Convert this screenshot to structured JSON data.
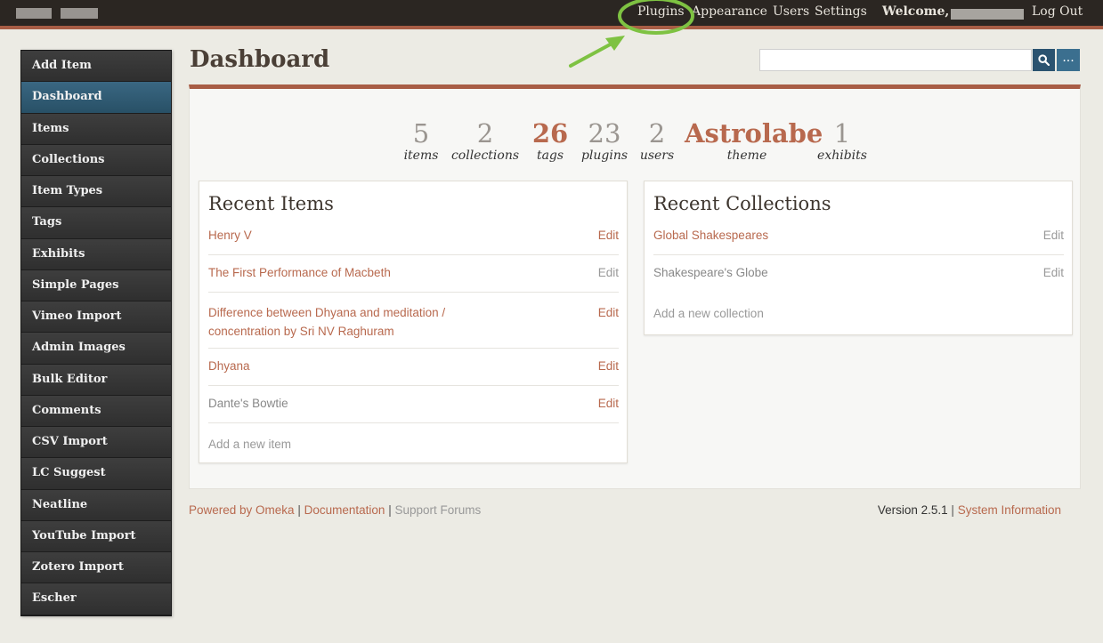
{
  "topbar": {
    "nav": [
      "Plugins",
      "Appearance",
      "Users",
      "Settings"
    ],
    "welcome": "Welcome,",
    "logout": "Log Out"
  },
  "sidebar": {
    "items": [
      {
        "label": "Add Item"
      },
      {
        "label": "Dashboard",
        "active": true
      },
      {
        "label": "Items"
      },
      {
        "label": "Collections"
      },
      {
        "label": "Item Types"
      },
      {
        "label": "Tags"
      },
      {
        "label": "Exhibits"
      },
      {
        "label": "Simple Pages"
      },
      {
        "label": "Vimeo Import"
      },
      {
        "label": "Admin Images"
      },
      {
        "label": "Bulk Editor"
      },
      {
        "label": "Comments"
      },
      {
        "label": "CSV Import"
      },
      {
        "label": "LC Suggest"
      },
      {
        "label": "Neatline"
      },
      {
        "label": "YouTube Import"
      },
      {
        "label": "Zotero Import"
      },
      {
        "label": "Escher"
      }
    ]
  },
  "header": {
    "title": "Dashboard",
    "search_value": "",
    "more_label": "..."
  },
  "stats": [
    {
      "value": "5",
      "label": "items"
    },
    {
      "value": "2",
      "label": "collections"
    },
    {
      "value": "26",
      "label": "tags"
    },
    {
      "value": "23",
      "label": "plugins"
    },
    {
      "value": "2",
      "label": "users"
    },
    {
      "value": "Astrolabe",
      "label": "theme"
    },
    {
      "value": "1",
      "label": "exhibits"
    }
  ],
  "recent_items": {
    "title": "Recent Items",
    "rows": [
      {
        "title": "Henry V",
        "edit": "Edit"
      },
      {
        "title": "The First Performance of Macbeth",
        "edit": "Edit"
      },
      {
        "title_line1": "Difference between Dhyana and meditation /",
        "title_line2": "concentration by Sri NV Raghuram",
        "edit": "Edit"
      },
      {
        "title": "Dhyana",
        "edit": "Edit"
      },
      {
        "title": "Dante's Bowtie",
        "edit": "Edit"
      }
    ],
    "add_label": "Add a new item"
  },
  "recent_collections": {
    "title": "Recent Collections",
    "rows": [
      {
        "title": "Global Shakespeares",
        "edit": "Edit"
      },
      {
        "title": "Shakespeare's Globe",
        "edit": "Edit"
      }
    ],
    "add_label": "Add a new collection"
  },
  "footer": {
    "powered": "Powered by Omeka",
    "documentation": "Documentation",
    "support": "Support Forums",
    "version": "Version 2.5.1",
    "system_info": "System Information",
    "separator": "|"
  },
  "colors": {
    "accent": "#a85d45",
    "link": "#b8694e",
    "sidebar_active": "#2f5d78",
    "annotation": "#7ec242"
  },
  "icons": [
    "search-icon",
    "more-icon",
    "annotation-arrow-icon"
  ]
}
